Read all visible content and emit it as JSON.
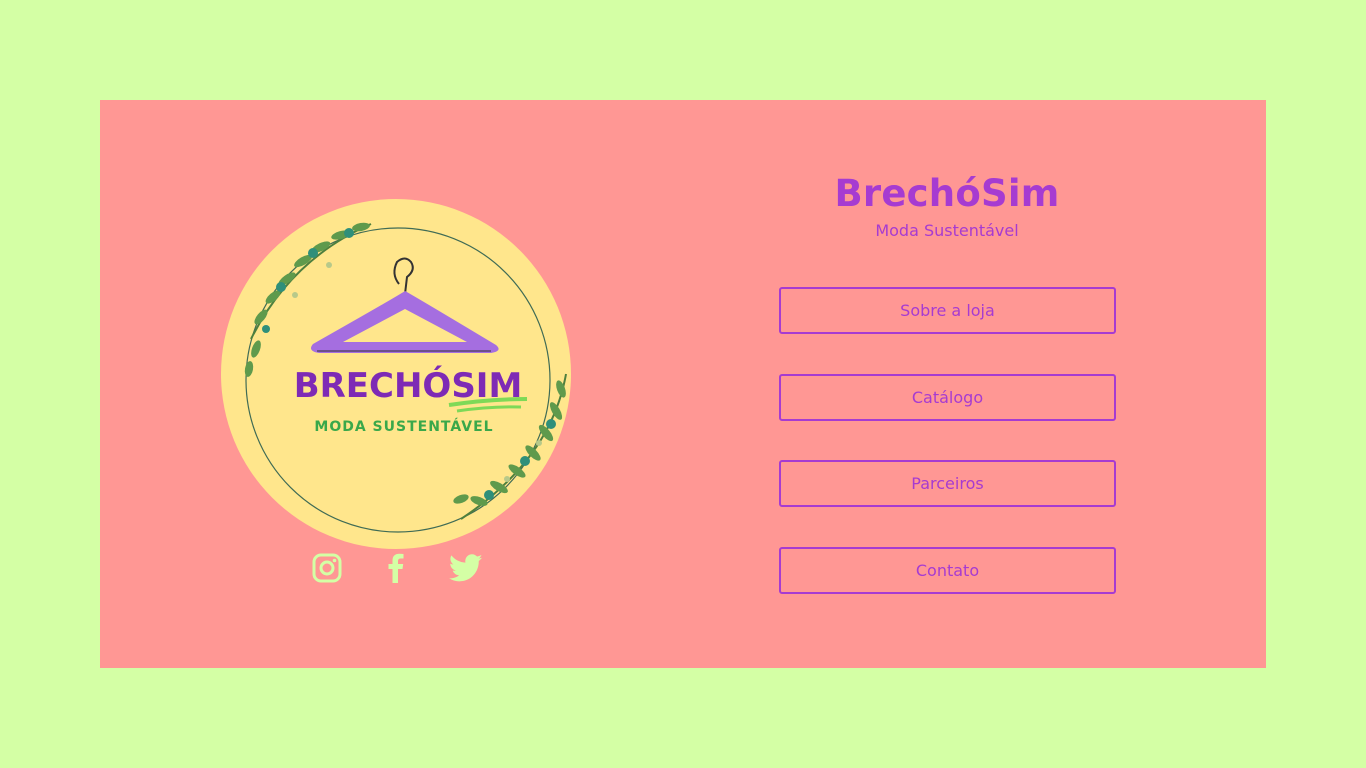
{
  "brand": {
    "title": "BrechóSim",
    "subtitle": "Moda Sustentável"
  },
  "logo": {
    "text": "BRECHÓSIM",
    "tagline": "MODA SUSTENTÁVEL"
  },
  "nav": [
    {
      "label": "Sobre a loja"
    },
    {
      "label": "Catálogo"
    },
    {
      "label": "Parceiros"
    },
    {
      "label": "Contato"
    }
  ],
  "social": [
    "instagram-icon",
    "facebook-icon",
    "twitter-icon"
  ],
  "colors": {
    "page_background": "#d4ffa5",
    "card_background": "#ff9794",
    "accent_purple": "#a63bd1",
    "logo_circle": "#ffe68c",
    "icon_color": "#d4ffa5"
  }
}
